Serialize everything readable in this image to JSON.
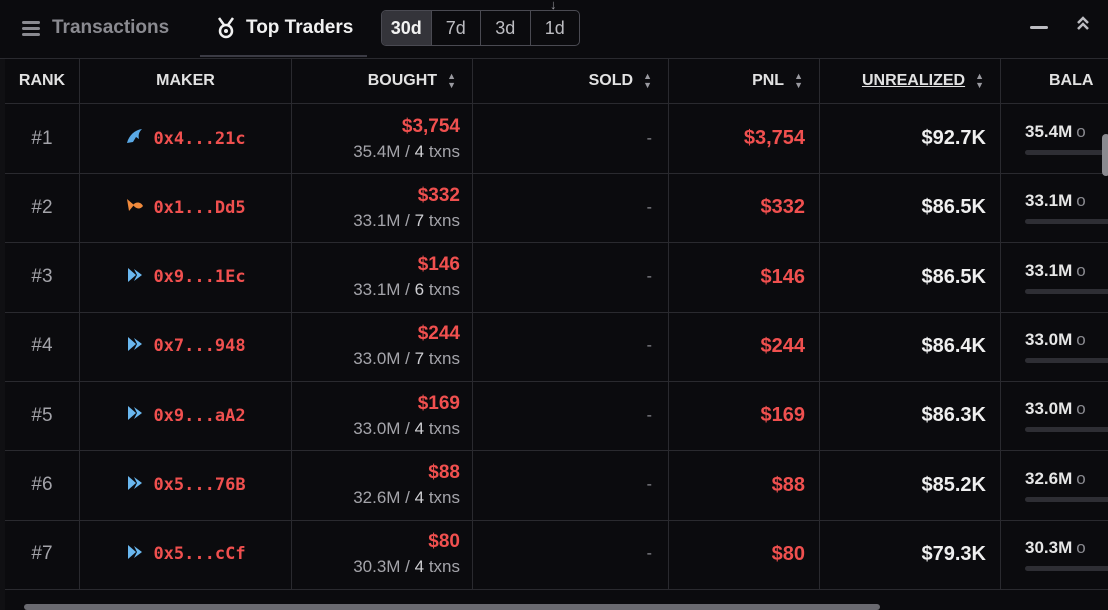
{
  "tabs": {
    "transactions": "Transactions",
    "top_traders": "Top Traders"
  },
  "periods": [
    "30d",
    "7d",
    "3d",
    "1d"
  ],
  "active_period": "30d",
  "columns": {
    "rank": "RANK",
    "maker": "MAKER",
    "bought": "BOUGHT",
    "sold": "SOLD",
    "pnl": "PNL",
    "unrealized": "UNREALIZED",
    "balance": "BALA"
  },
  "rows": [
    {
      "rank": "#1",
      "icon": "dolphin-icon",
      "maker": "0x4...21c",
      "bought": "$3,754",
      "bought_amount": "35.4M",
      "bought_txns": "4",
      "sold": "-",
      "pnl": "$3,754",
      "unrealized": "$92.7K",
      "balance": "35.4M"
    },
    {
      "rank": "#2",
      "icon": "fish-icon",
      "maker": "0x1...Dd5",
      "bought": "$332",
      "bought_amount": "33.1M",
      "bought_txns": "7",
      "sold": "-",
      "pnl": "$332",
      "unrealized": "$86.5K",
      "balance": "33.1M"
    },
    {
      "rank": "#3",
      "icon": "shrimp-icon",
      "maker": "0x9...1Ec",
      "bought": "$146",
      "bought_amount": "33.1M",
      "bought_txns": "6",
      "sold": "-",
      "pnl": "$146",
      "unrealized": "$86.5K",
      "balance": "33.1M"
    },
    {
      "rank": "#4",
      "icon": "shrimp-icon",
      "maker": "0x7...948",
      "bought": "$244",
      "bought_amount": "33.0M",
      "bought_txns": "7",
      "sold": "-",
      "pnl": "$244",
      "unrealized": "$86.4K",
      "balance": "33.0M"
    },
    {
      "rank": "#5",
      "icon": "shrimp-icon",
      "maker": "0x9...aA2",
      "bought": "$169",
      "bought_amount": "33.0M",
      "bought_txns": "4",
      "sold": "-",
      "pnl": "$169",
      "unrealized": "$86.3K",
      "balance": "33.0M"
    },
    {
      "rank": "#6",
      "icon": "shrimp-icon",
      "maker": "0x5...76B",
      "bought": "$88",
      "bought_amount": "32.6M",
      "bought_txns": "4",
      "sold": "-",
      "pnl": "$88",
      "unrealized": "$85.2K",
      "balance": "32.6M"
    },
    {
      "rank": "#7",
      "icon": "shrimp-icon",
      "maker": "0x5...cCf",
      "bought": "$80",
      "bought_amount": "30.3M",
      "bought_txns": "4",
      "sold": "-",
      "pnl": "$80",
      "unrealized": "$79.3K",
      "balance": "30.3M"
    }
  ],
  "labels": {
    "txns": "txns",
    "of": "o"
  },
  "colors": {
    "background": "#0b0b0e",
    "negative": "#f0504f",
    "dolphin": "#5aa9e6",
    "fish": "#f08a3c",
    "shrimp": "#6ab8f0"
  }
}
